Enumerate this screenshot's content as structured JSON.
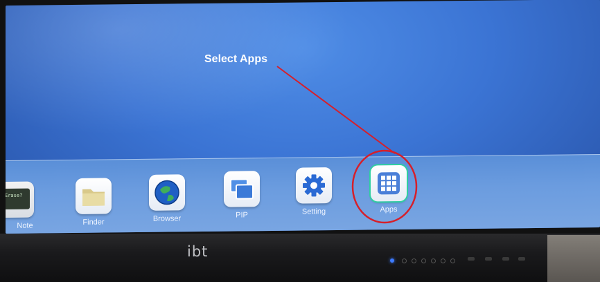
{
  "annotation": {
    "text": "Select Apps",
    "color": "#d61f2a"
  },
  "dock": {
    "items": [
      {
        "label": "Note",
        "icon": "note-icon"
      },
      {
        "label": "Finder",
        "icon": "folder-icon"
      },
      {
        "label": "Browser",
        "icon": "globe-icon"
      },
      {
        "label": "PIP",
        "icon": "pip-icon"
      },
      {
        "label": "Setting",
        "icon": "gear-icon"
      },
      {
        "label": "Apps",
        "icon": "apps-grid-icon"
      }
    ]
  },
  "note_icon_text": "Erase?",
  "bezel": {
    "brand": "ibt"
  },
  "colors": {
    "screen": "#3b74d4",
    "dock": "#6b9cdf",
    "status_led": "#3d7bff"
  }
}
